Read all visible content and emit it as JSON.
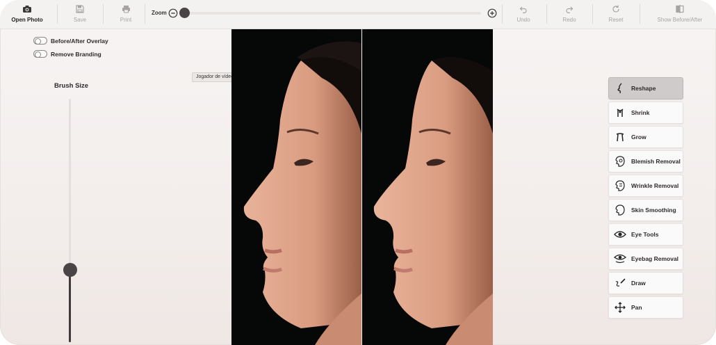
{
  "toolbar": {
    "open_photo": "Open Photo",
    "save": "Save",
    "print": "Print",
    "zoom": "Zoom",
    "undo": "Undo",
    "redo": "Redo",
    "reset": "Reset",
    "show_before_after": "Show Before/After",
    "zoom_level": 0
  },
  "options": {
    "overlay_label": "Before/After Overlay",
    "overlay_on": false,
    "branding_label": "Remove Branding",
    "branding_on": false
  },
  "brush": {
    "title": "Brush Size",
    "level": 0.3
  },
  "tooltip": "Jogador de vídeo",
  "tools": [
    {
      "label": "Reshape",
      "icon": "reshape-icon",
      "selected": true
    },
    {
      "label": "Shrink",
      "icon": "shrink-icon",
      "selected": false
    },
    {
      "label": "Grow",
      "icon": "grow-icon",
      "selected": false
    },
    {
      "label": "Blemish Removal",
      "icon": "blemish-icon",
      "selected": false
    },
    {
      "label": "Wrinkle Removal",
      "icon": "wrinkle-icon",
      "selected": false
    },
    {
      "label": "Skin Smoothing",
      "icon": "skin-smoothing-icon",
      "selected": false
    },
    {
      "label": "Eye Tools",
      "icon": "eye-icon",
      "selected": false
    },
    {
      "label": "Eyebag Removal",
      "icon": "eyebag-icon",
      "selected": false
    },
    {
      "label": "Draw",
      "icon": "draw-icon",
      "selected": false
    },
    {
      "label": "Pan",
      "icon": "pan-icon",
      "selected": false
    }
  ],
  "colors": {
    "accent": "#4a4446",
    "photo_bg": "#070808",
    "skin": "#e6b198",
    "selected_tool": "#cfcbca"
  }
}
